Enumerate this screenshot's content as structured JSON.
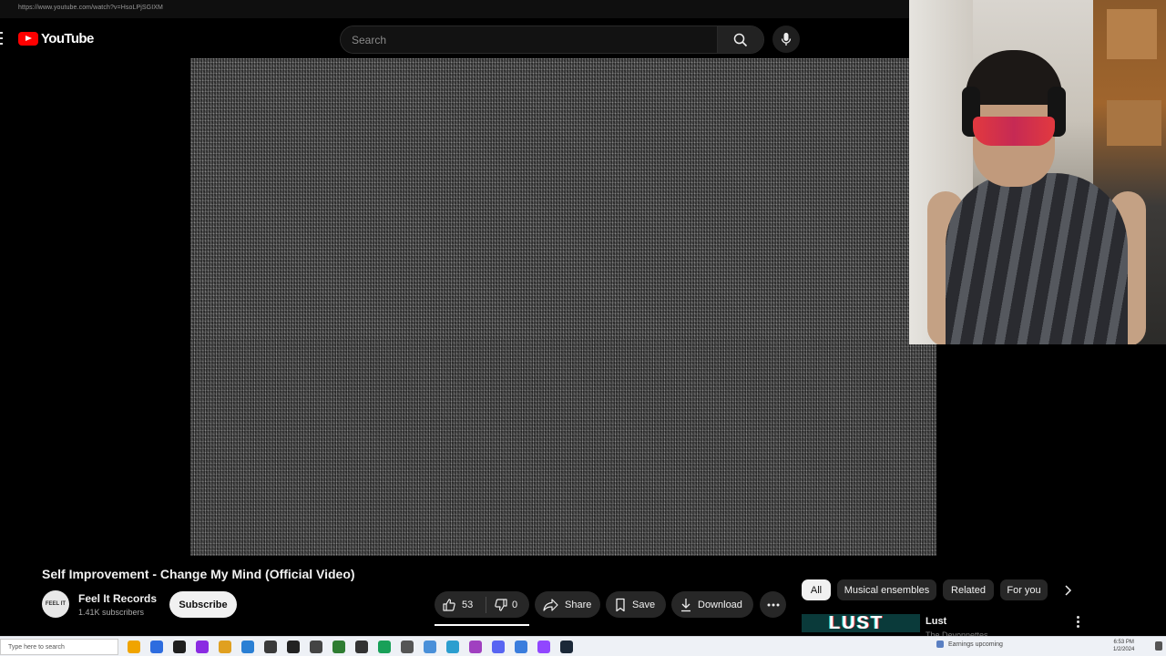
{
  "browser": {
    "url": "https://www.youtube.com/watch?v=HsoLPjSGIXM"
  },
  "header": {
    "logo_text": "YouTube",
    "search_placeholder": "Search"
  },
  "video": {
    "title": "Self Improvement - Change My Mind (Official Video)",
    "channel_name": "Feel It Records",
    "subscribers": "1.41K subscribers",
    "avatar_text": "FEEL IT",
    "subscribe_label": "Subscribe",
    "likes": "53",
    "dislikes": "0",
    "share_label": "Share",
    "save_label": "Save",
    "download_label": "Download"
  },
  "chips": [
    {
      "label": "All",
      "active": true
    },
    {
      "label": "Musical ensembles",
      "active": false
    },
    {
      "label": "Related",
      "active": false
    },
    {
      "label": "For you",
      "active": false
    }
  ],
  "recommendation": {
    "thumb_text": "LUST",
    "title": "Lust",
    "channel": "The Devonnettes"
  },
  "taskbar": {
    "search_placeholder": "Type here to search",
    "tray_text": "Earnings upcoming",
    "time": "6:53 PM",
    "date": "1/2/2024"
  },
  "colors": {
    "accent": "#ff0000",
    "background": "#000000",
    "pill": "#272727"
  }
}
